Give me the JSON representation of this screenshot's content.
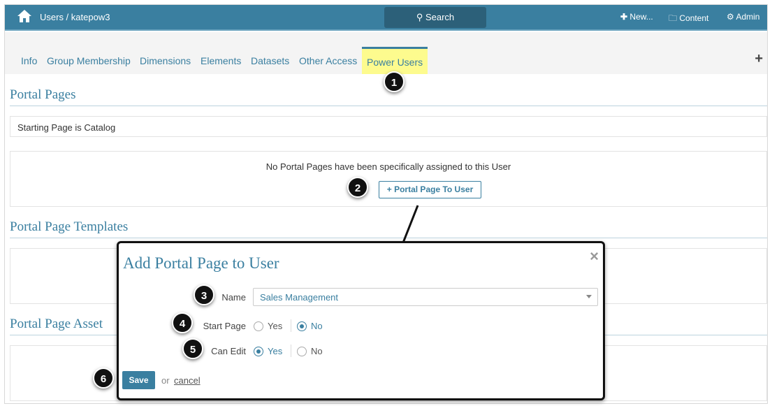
{
  "header": {
    "breadcrumb": "Users / katepow3",
    "search_label": "Search",
    "new_label": "New...",
    "content_label": "Content",
    "admin_label": "Admin"
  },
  "tabs": [
    "Info",
    "Group Membership",
    "Dimensions",
    "Elements",
    "Datasets",
    "Other Access",
    "Power Users"
  ],
  "sections": {
    "portal_pages": "Portal Pages",
    "starting_page": "Starting Page is Catalog",
    "no_pages": "No Portal Pages have been specifically assigned to this User",
    "add_button": "+ Portal Page To User",
    "templates": "Portal Page Templates",
    "assets": "Portal Page Asset"
  },
  "modal": {
    "title": "Add Portal Page to User",
    "close": "×",
    "name_label": "Name",
    "name_value": "Sales Management",
    "start_page_label": "Start Page",
    "can_edit_label": "Can Edit",
    "yes": "Yes",
    "no": "No",
    "start_page_value": "No",
    "can_edit_value": "Yes",
    "save": "Save",
    "or": "or",
    "cancel": "cancel"
  },
  "callouts": [
    "1",
    "2",
    "3",
    "4",
    "5",
    "6"
  ]
}
